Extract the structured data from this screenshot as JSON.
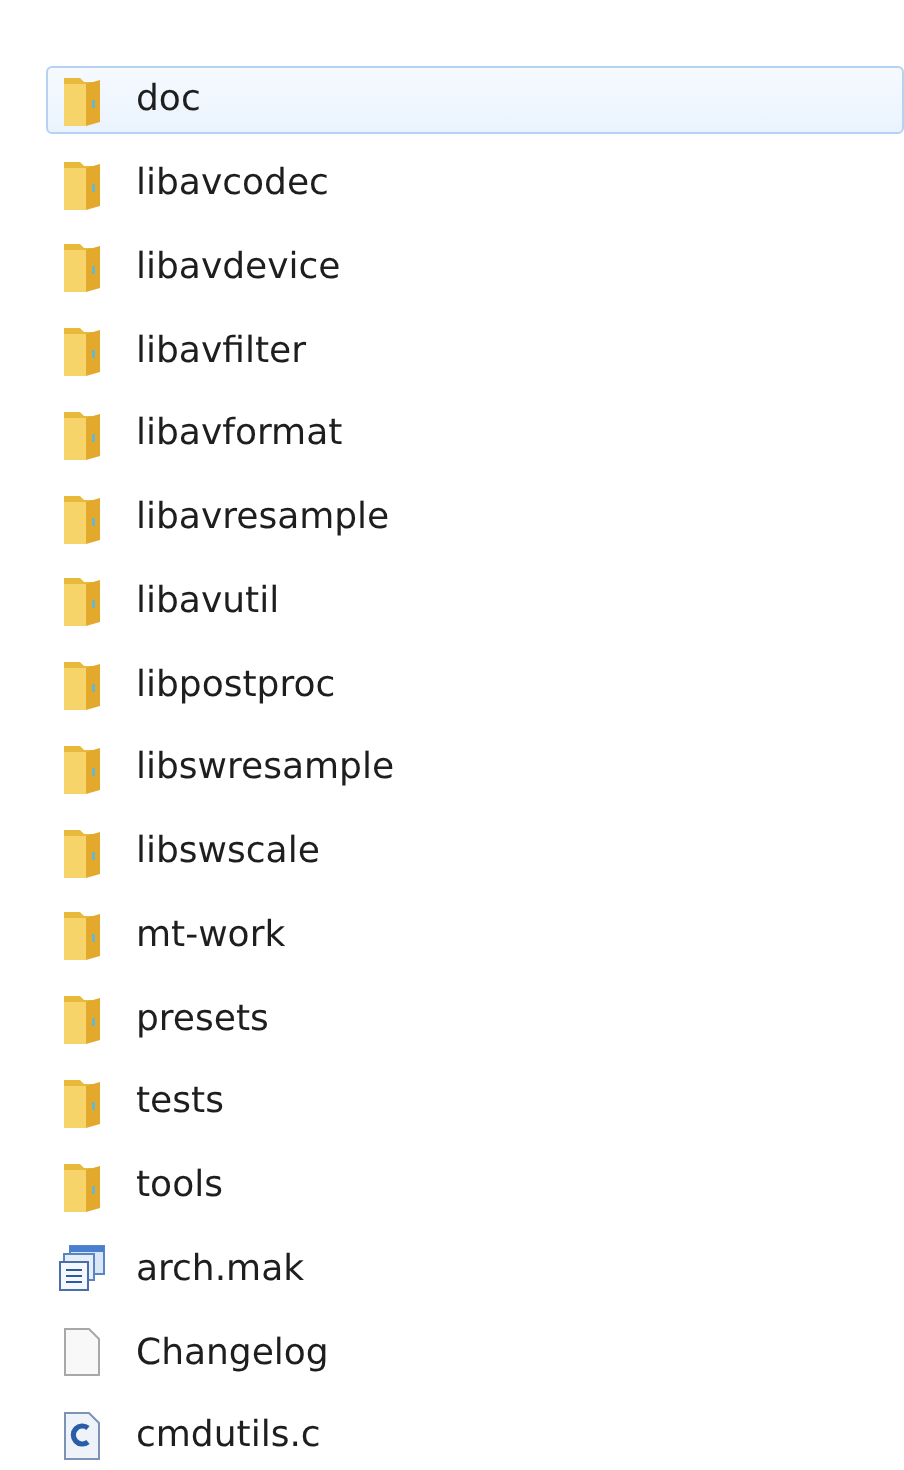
{
  "files": [
    {
      "name": "doc",
      "kind": "folder",
      "selected": true
    },
    {
      "name": "libavcodec",
      "kind": "folder",
      "selected": false
    },
    {
      "name": "libavdevice",
      "kind": "folder",
      "selected": false
    },
    {
      "name": "libavfilter",
      "kind": "folder",
      "selected": false
    },
    {
      "name": "libavformat",
      "kind": "folder",
      "selected": false
    },
    {
      "name": "libavresample",
      "kind": "folder",
      "selected": false
    },
    {
      "name": "libavutil",
      "kind": "folder",
      "selected": false
    },
    {
      "name": "libpostproc",
      "kind": "folder",
      "selected": false
    },
    {
      "name": "libswresample",
      "kind": "folder",
      "selected": false
    },
    {
      "name": "libswscale",
      "kind": "folder",
      "selected": false
    },
    {
      "name": "mt-work",
      "kind": "folder",
      "selected": false
    },
    {
      "name": "presets",
      "kind": "folder",
      "selected": false
    },
    {
      "name": "tests",
      "kind": "folder",
      "selected": false
    },
    {
      "name": "tools",
      "kind": "folder",
      "selected": false
    },
    {
      "name": "arch.mak",
      "kind": "makefile",
      "selected": false
    },
    {
      "name": "Changelog",
      "kind": "file",
      "selected": false
    },
    {
      "name": "cmdutils.c",
      "kind": "csource",
      "selected": false
    }
  ]
}
